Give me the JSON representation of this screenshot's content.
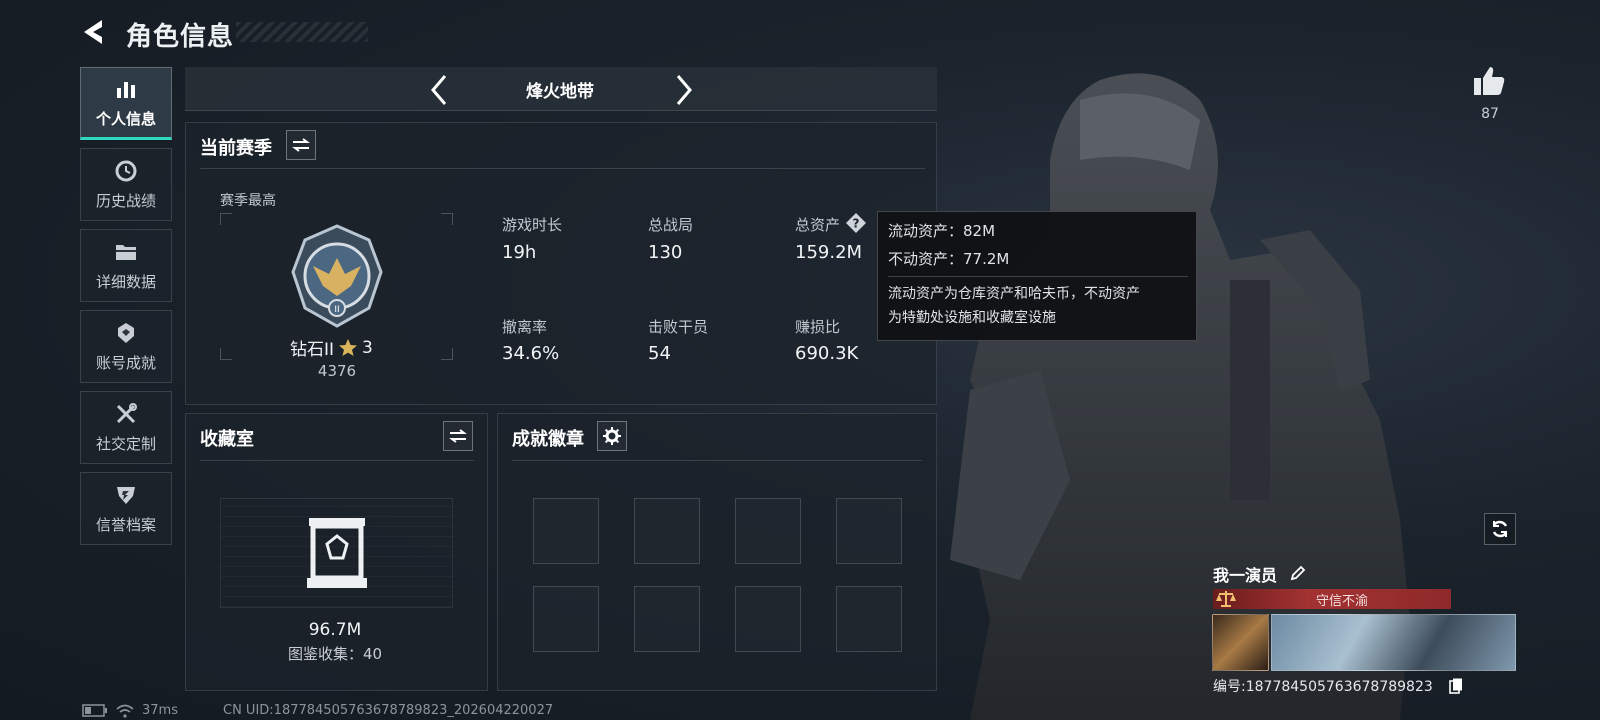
{
  "header": {
    "title": "角色信息"
  },
  "nav": {
    "items": [
      {
        "label": "个人信息",
        "icon": "bar-chart-icon",
        "active": true
      },
      {
        "label": "历史战绩",
        "icon": "clock-icon"
      },
      {
        "label": "详细数据",
        "icon": "folder-icon"
      },
      {
        "label": "账号成就",
        "icon": "achievement-icon"
      },
      {
        "label": "社交定制",
        "icon": "tools-icon"
      },
      {
        "label": "信誉档案",
        "icon": "reputation-icon"
      }
    ]
  },
  "mode": {
    "label": "烽火地带"
  },
  "season": {
    "title": "当前赛季",
    "best_label": "赛季最高",
    "rank_name": "钻石II",
    "rank_stars": "3",
    "rank_score": "4376",
    "stats": [
      {
        "label": "游戏时长",
        "value": "19h"
      },
      {
        "label": "总战局",
        "value": "130"
      },
      {
        "label": "总资产",
        "value": "159.2M"
      },
      {
        "label": "撤离率",
        "value": "34.6%"
      },
      {
        "label": "击败干员",
        "value": "54"
      },
      {
        "label": "赚损比",
        "value": "690.3K"
      }
    ]
  },
  "tooltip": {
    "line1": "流动资产：82M",
    "line2": "不动资产：77.2M",
    "desc1": "流动资产为仓库资产和哈夫币，不动资产",
    "desc2": "为特勤处设施和收藏室设施"
  },
  "collection": {
    "title": "收藏室",
    "value": "96.7M",
    "count_text": "图鉴收集：40"
  },
  "achievements": {
    "title": "成就徽章"
  },
  "profile": {
    "likes": "87",
    "name": "我一演员",
    "badge": "守信不渝",
    "uid": "编号:18778450576367878982​3"
  },
  "status": {
    "latency": "37ms",
    "uid_footer": "CN UID:18778450576367878982​3_202604220027"
  },
  "colors": {
    "accent": "#2fd9c0",
    "badge_red": "#a33232"
  }
}
